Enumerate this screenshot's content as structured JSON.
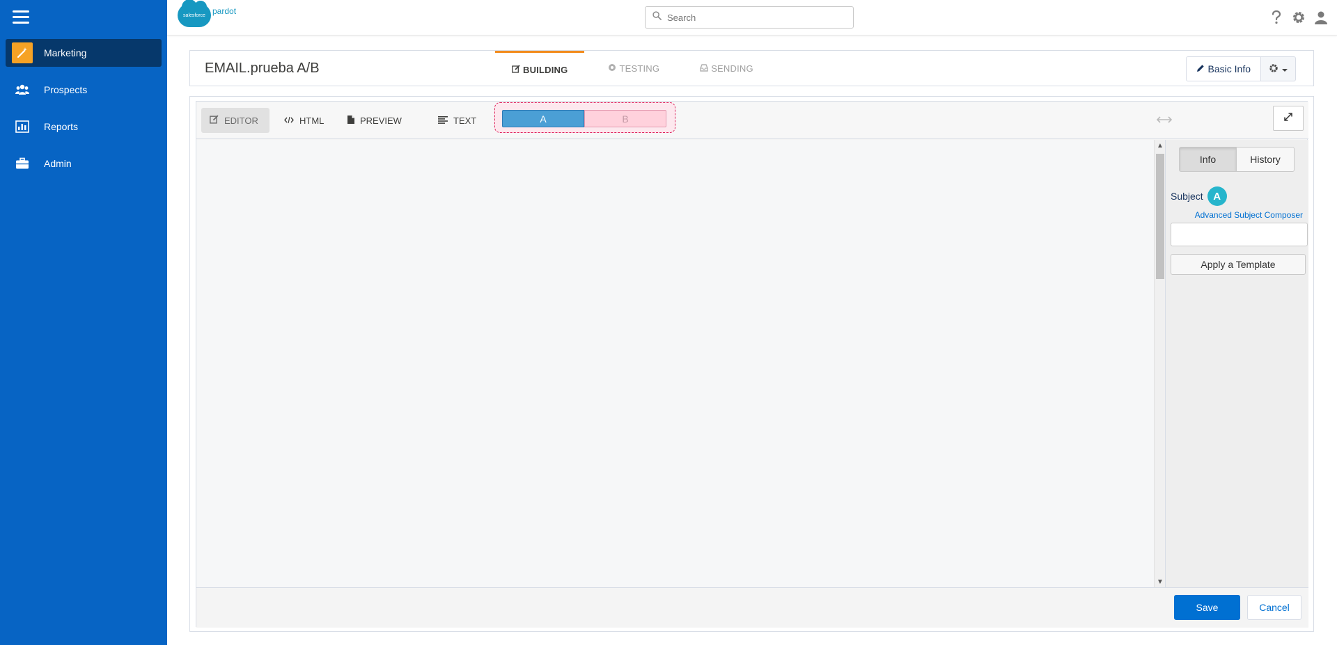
{
  "brand": {
    "logo_cloud_text": "salesforce",
    "logo_product": "pardot"
  },
  "search": {
    "placeholder": "Search"
  },
  "sidebar": {
    "items": [
      {
        "label": "Marketing",
        "icon": "wand-icon",
        "active": true
      },
      {
        "label": "Prospects",
        "icon": "people-icon",
        "active": false
      },
      {
        "label": "Reports",
        "icon": "bar-chart-icon",
        "active": false
      },
      {
        "label": "Admin",
        "icon": "briefcase-icon",
        "active": false
      }
    ]
  },
  "page": {
    "title": "EMAIL.prueba A/B",
    "steps": [
      {
        "label": "BUILDING",
        "active": true
      },
      {
        "label": "TESTING",
        "active": false
      },
      {
        "label": "SENDING",
        "active": false
      }
    ],
    "basic_info_label": "Basic Info"
  },
  "toolbar": {
    "editor_label": "EDITOR",
    "html_label": "HTML",
    "preview_label": "PREVIEW",
    "text_label": "TEXT",
    "variant_a": "A",
    "variant_b": "B"
  },
  "right_panel": {
    "tab_info": "Info",
    "tab_history": "History",
    "subject_label": "Subject",
    "variant_badge": "A",
    "advanced_link": "Advanced Subject Composer",
    "subject_value": "",
    "apply_template_label": "Apply a Template"
  },
  "footer": {
    "save_label": "Save",
    "cancel_label": "Cancel"
  },
  "colors": {
    "sidebar_bg": "#0764c4",
    "sidebar_active": "#06386b",
    "accent_orange": "#f28c1e",
    "primary_blue": "#0070d2",
    "variant_a": "#4b9fd5",
    "variant_b": "#ffd1dc"
  }
}
